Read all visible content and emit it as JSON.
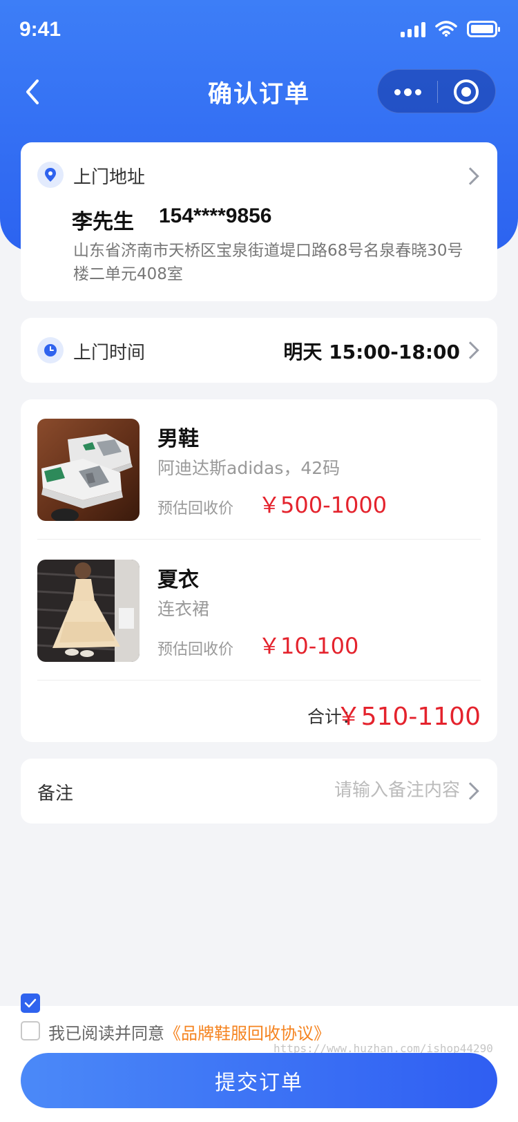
{
  "status_bar": {
    "time": "9:41"
  },
  "nav": {
    "title": "确认订单"
  },
  "address": {
    "label": "上门地址",
    "name": "李先生",
    "phone": "154****9856",
    "detail": "山东省济南市天桥区宝泉街道堤口路68号名泉春晓30号楼二单元408室"
  },
  "visit_time": {
    "label": "上门时间",
    "value": "明天 15:00-18:00"
  },
  "items": [
    {
      "name": "男鞋",
      "desc": "阿迪达斯adidas，42码",
      "price_label": "预估回收价",
      "price": "￥500-1000"
    },
    {
      "name": "夏衣",
      "desc": "连衣裙",
      "price_label": "预估回收价",
      "price": "￥10-100"
    }
  ],
  "total": {
    "label": "合计：",
    "value": "￥510-1100"
  },
  "note": {
    "label": "备注",
    "placeholder": "请输入备注内容"
  },
  "agreement": {
    "prefix": "我已阅读并同意",
    "link": "《品牌鞋服回收协议》"
  },
  "submit": {
    "label": "提交订单"
  },
  "watermark": "https://www.huzhan.com/ishop44290",
  "colors": {
    "primary": "#2f63ee",
    "price": "#e4232d",
    "link": "#f5831f"
  }
}
